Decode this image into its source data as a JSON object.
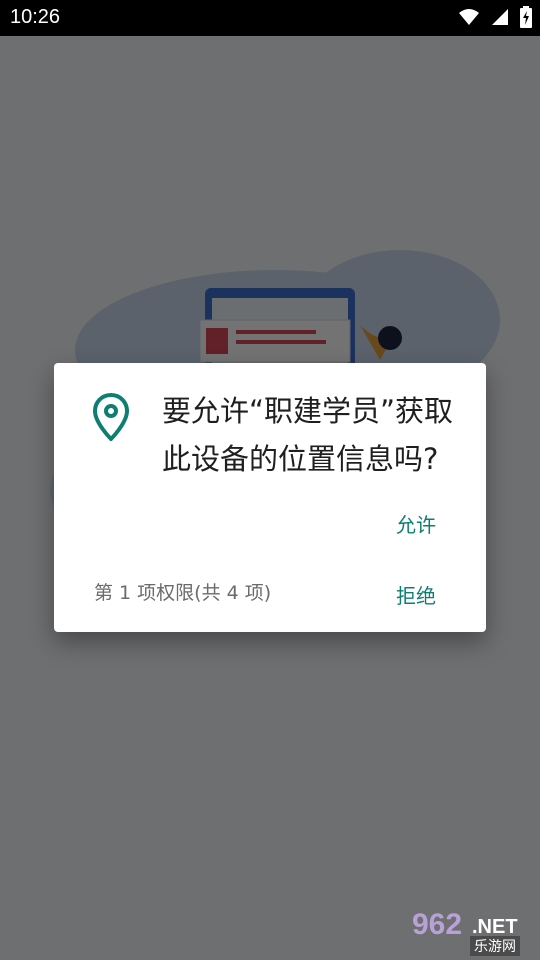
{
  "status_bar": {
    "time": "10:26",
    "icons": [
      "wifi-icon",
      "signal-icon",
      "battery-icon"
    ]
  },
  "dialog": {
    "message": "要允许“职建学员”获取此设备的位置信息吗?",
    "allow_label": "允许",
    "deny_label": "拒绝",
    "permission_count": "第 1 项权限(共 4 项)",
    "icon": "location-pin-icon",
    "accent_color": "#0f7e72"
  },
  "watermark": {
    "number": "962",
    "net": ".NET",
    "sub": "乐游网"
  }
}
